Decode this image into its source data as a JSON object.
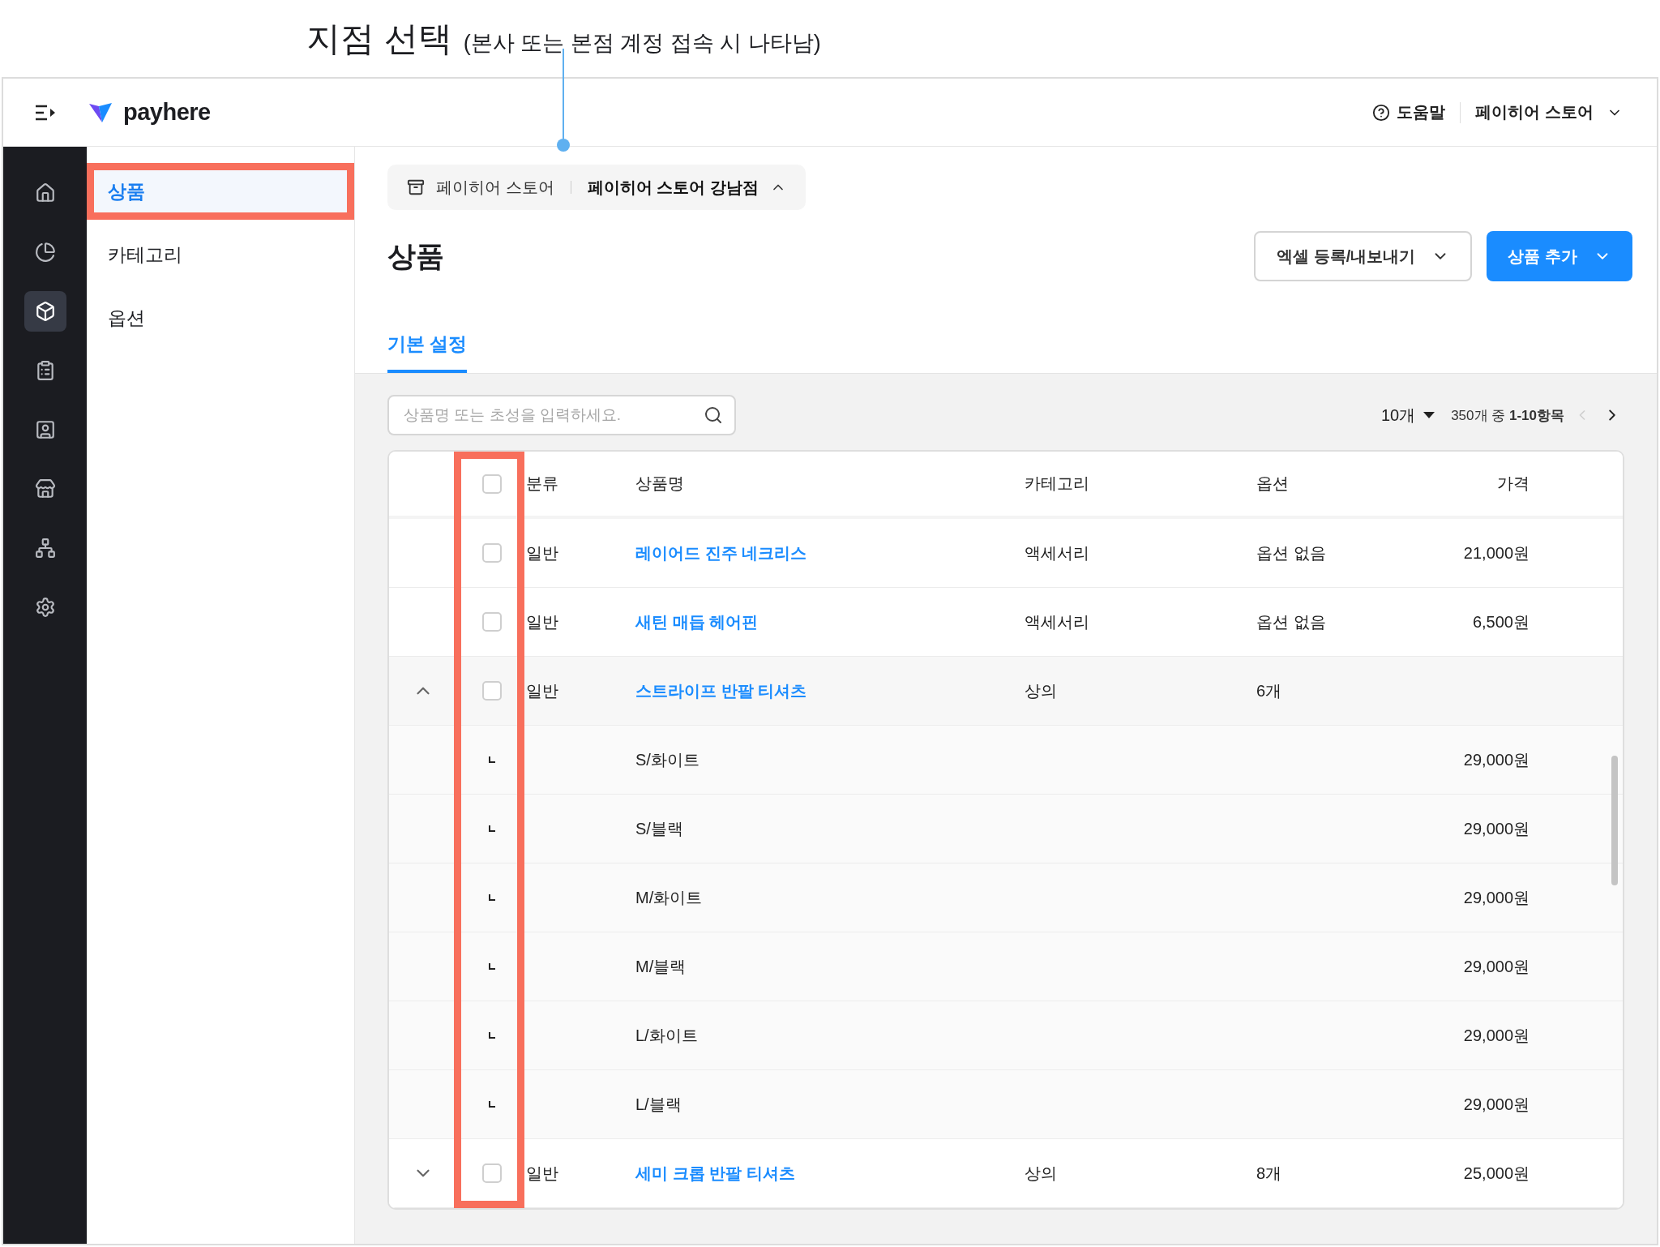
{
  "annotation": {
    "title": "지점 선택",
    "note": "(본사 또는 본점 계정 접속 시 나타남)"
  },
  "header": {
    "logo": "payhere",
    "help": "도움말",
    "account": "페이히어 스토어"
  },
  "nav": [
    {
      "kind": "home",
      "selected": false
    },
    {
      "kind": "chart",
      "selected": false
    },
    {
      "kind": "box",
      "selected": true
    },
    {
      "kind": "clipboard",
      "selected": false
    },
    {
      "kind": "contact",
      "selected": false
    },
    {
      "kind": "store",
      "selected": false
    },
    {
      "kind": "network",
      "selected": false
    },
    {
      "kind": "settings",
      "selected": false
    }
  ],
  "submenu": [
    {
      "label": "상품",
      "selected": true,
      "highlighted": true
    },
    {
      "label": "카테고리",
      "selected": false,
      "highlighted": false
    },
    {
      "label": "옵션",
      "selected": false,
      "highlighted": false
    }
  ],
  "branch": {
    "store": "페이히어 스토어",
    "branch": "페이히어 스토어 강남점",
    "expanded": true
  },
  "page_title": "상품",
  "buttons": [
    {
      "label": "엑셀 등록/내보내기",
      "kind": "secondary"
    },
    {
      "label": "상품 추가",
      "kind": "primary"
    }
  ],
  "tabs": [
    {
      "label": "기본 설정",
      "selected": true
    }
  ],
  "search": {
    "placeholder": "상품명 또는 초성을 입력하세요."
  },
  "pagination": {
    "page_size": "10개",
    "summary_prefix": "350개 중",
    "summary_range": "1-10항목",
    "prev_disabled": true
  },
  "table": {
    "highlight_checkbox_column": true,
    "columns": [
      "분류",
      "상품명",
      "카테고리",
      "옵션",
      "가격"
    ],
    "header_checked": false,
    "rows": [
      {
        "kind": "product",
        "checked": false,
        "type": "일반",
        "name": "레이어드 진주 네크리스",
        "category": "액세서리",
        "option": "옵션 없음",
        "price": "21,000원"
      },
      {
        "kind": "product",
        "checked": false,
        "type": "일반",
        "name": "새틴 매듭 헤어핀",
        "category": "액세서리",
        "option": "옵션 없음",
        "price": "6,500원"
      },
      {
        "kind": "product",
        "checked": false,
        "expanded": true,
        "type": "일반",
        "name": "스트라이프 반팔 티셔츠",
        "category": "상의",
        "option": "6개"
      },
      {
        "kind": "option",
        "name": "S/화이트",
        "price": "29,000원"
      },
      {
        "kind": "option",
        "name": "S/블랙",
        "price": "29,000원"
      },
      {
        "kind": "option",
        "name": "M/화이트",
        "price": "29,000원"
      },
      {
        "kind": "option",
        "name": "M/블랙",
        "price": "29,000원"
      },
      {
        "kind": "option",
        "name": "L/화이트",
        "price": "29,000원"
      },
      {
        "kind": "option",
        "name": "L/블랙",
        "price": "29,000원"
      },
      {
        "kind": "product",
        "checked": false,
        "expanded": false,
        "type": "일반",
        "name": "세미 크롭 반팔 티셔츠",
        "category": "상의",
        "option": "8개",
        "price": "25,000원"
      }
    ]
  }
}
